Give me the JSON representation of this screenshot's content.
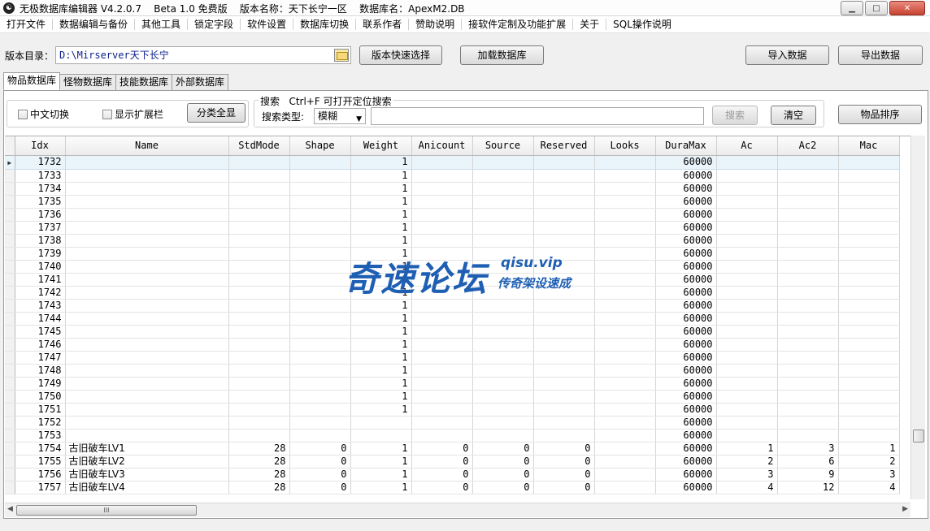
{
  "window": {
    "title": "无极数据库编辑器 V4.2.0.7    Beta 1.0 免费版    版本名称：天下长宁一区    数据库名：ApexM2.DB",
    "minimize_glyph": "▁",
    "maximize_glyph": "□",
    "close_glyph": "✕"
  },
  "menu": [
    "打开文件",
    "数据编辑与备份",
    "其他工具",
    "锁定字段",
    "软件设置",
    "数据库切换",
    "联系作者",
    "赞助说明",
    "接软件定制及功能扩展",
    "关于",
    "SQL操作说明"
  ],
  "toolbar": {
    "dir_label": "版本目录：",
    "dir_value": "D:\\Mirserver天下长宁",
    "quick_select": "版本快速选择",
    "load_db": "加载数据库",
    "import": "导入数据",
    "export": "导出数据"
  },
  "tabs": [
    "物品数据库",
    "怪物数据库",
    "技能数据库",
    "外部数据库"
  ],
  "filters": {
    "chinese_switch": "中文切换",
    "show_ext": "显示扩展栏",
    "show_all": "分类全显",
    "search_legend": "搜索   Ctrl+F 可打开定位搜索",
    "search_type_label": "搜索类型:",
    "search_type_value": "模糊",
    "search_btn": "搜索",
    "clear_btn": "清空",
    "sort_btn": "物品排序"
  },
  "grid": {
    "columns": [
      "Idx",
      "Name",
      "StdMode",
      "Shape",
      "Weight",
      "Anicount",
      "Source",
      "Reserved",
      "Looks",
      "DuraMax",
      "Ac",
      "Ac2",
      "Mac"
    ],
    "rows": [
      [
        "1732",
        "",
        "",
        "",
        "1",
        "",
        "",
        "",
        "",
        "60000",
        "",
        "",
        ""
      ],
      [
        "1733",
        "",
        "",
        "",
        "1",
        "",
        "",
        "",
        "",
        "60000",
        "",
        "",
        ""
      ],
      [
        "1734",
        "",
        "",
        "",
        "1",
        "",
        "",
        "",
        "",
        "60000",
        "",
        "",
        ""
      ],
      [
        "1735",
        "",
        "",
        "",
        "1",
        "",
        "",
        "",
        "",
        "60000",
        "",
        "",
        ""
      ],
      [
        "1736",
        "",
        "",
        "",
        "1",
        "",
        "",
        "",
        "",
        "60000",
        "",
        "",
        ""
      ],
      [
        "1737",
        "",
        "",
        "",
        "1",
        "",
        "",
        "",
        "",
        "60000",
        "",
        "",
        ""
      ],
      [
        "1738",
        "",
        "",
        "",
        "1",
        "",
        "",
        "",
        "",
        "60000",
        "",
        "",
        ""
      ],
      [
        "1739",
        "",
        "",
        "",
        "1",
        "",
        "",
        "",
        "",
        "60000",
        "",
        "",
        ""
      ],
      [
        "1740",
        "",
        "",
        "",
        "1",
        "",
        "",
        "",
        "",
        "60000",
        "",
        "",
        ""
      ],
      [
        "1741",
        "",
        "",
        "",
        "1",
        "",
        "",
        "",
        "",
        "60000",
        "",
        "",
        ""
      ],
      [
        "1742",
        "",
        "",
        "",
        "1",
        "",
        "",
        "",
        "",
        "60000",
        "",
        "",
        ""
      ],
      [
        "1743",
        "",
        "",
        "",
        "1",
        "",
        "",
        "",
        "",
        "60000",
        "",
        "",
        ""
      ],
      [
        "1744",
        "",
        "",
        "",
        "1",
        "",
        "",
        "",
        "",
        "60000",
        "",
        "",
        ""
      ],
      [
        "1745",
        "",
        "",
        "",
        "1",
        "",
        "",
        "",
        "",
        "60000",
        "",
        "",
        ""
      ],
      [
        "1746",
        "",
        "",
        "",
        "1",
        "",
        "",
        "",
        "",
        "60000",
        "",
        "",
        ""
      ],
      [
        "1747",
        "",
        "",
        "",
        "1",
        "",
        "",
        "",
        "",
        "60000",
        "",
        "",
        ""
      ],
      [
        "1748",
        "",
        "",
        "",
        "1",
        "",
        "",
        "",
        "",
        "60000",
        "",
        "",
        ""
      ],
      [
        "1749",
        "",
        "",
        "",
        "1",
        "",
        "",
        "",
        "",
        "60000",
        "",
        "",
        ""
      ],
      [
        "1750",
        "",
        "",
        "",
        "1",
        "",
        "",
        "",
        "",
        "60000",
        "",
        "",
        ""
      ],
      [
        "1751",
        "",
        "",
        "",
        "1",
        "",
        "",
        "",
        "",
        "60000",
        "",
        "",
        ""
      ],
      [
        "1752",
        "",
        "",
        "",
        "",
        "",
        "",
        "",
        "",
        "60000",
        "",
        "",
        ""
      ],
      [
        "1753",
        "",
        "",
        "",
        "",
        "",
        "",
        "",
        "",
        "60000",
        "",
        "",
        ""
      ],
      [
        "1754",
        "古旧破车LV1",
        "28",
        "0",
        "1",
        "0",
        "0",
        "0",
        "",
        "60000",
        "1",
        "3",
        "1"
      ],
      [
        "1755",
        "古旧破车LV2",
        "28",
        "0",
        "1",
        "0",
        "0",
        "0",
        "",
        "60000",
        "2",
        "6",
        "2"
      ],
      [
        "1756",
        "古旧破车LV3",
        "28",
        "0",
        "1",
        "0",
        "0",
        "0",
        "",
        "60000",
        "3",
        "9",
        "3"
      ],
      [
        "1757",
        "古旧破车LV4",
        "28",
        "0",
        "1",
        "0",
        "0",
        "0",
        "",
        "60000",
        "4",
        "12",
        "4"
      ]
    ],
    "current_row_marker": "▶"
  },
  "scrollbar": {
    "grip_glyph": "III",
    "left_arrow": "◀",
    "right_arrow": "▶"
  },
  "watermark": {
    "title": "奇速论坛",
    "domain": "qisu.vip",
    "tagline": "传奇架设速成"
  }
}
